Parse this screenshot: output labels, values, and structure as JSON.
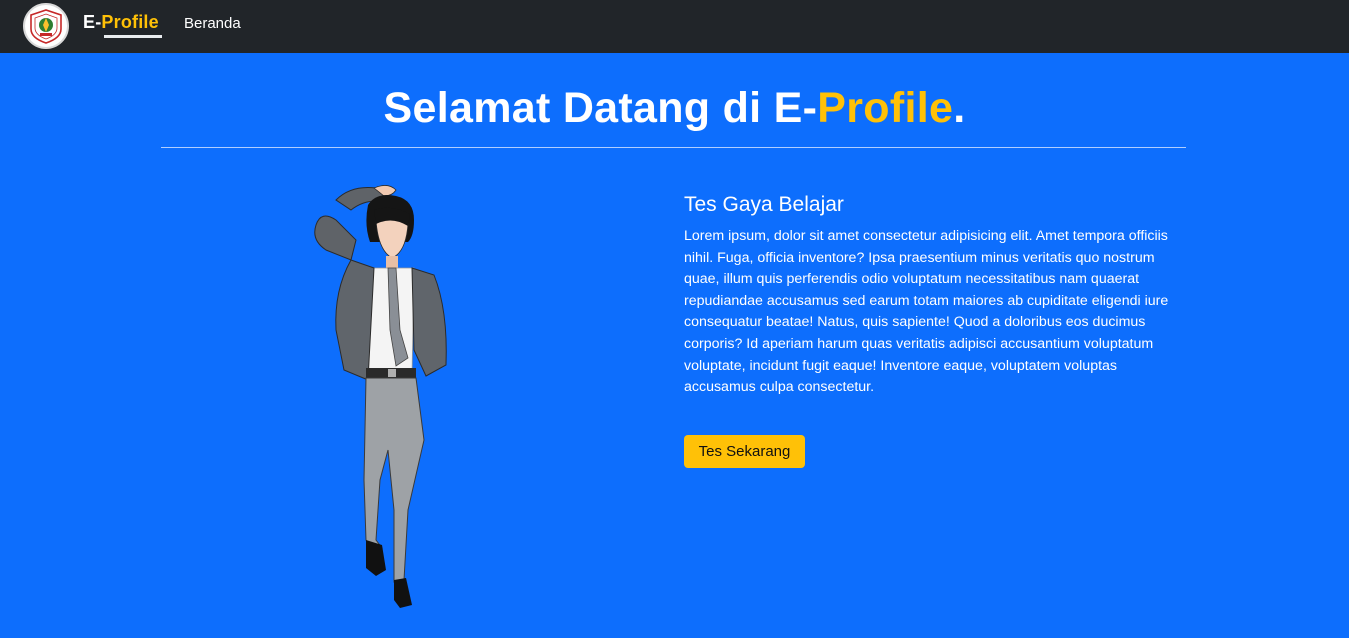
{
  "navbar": {
    "brand_prefix": "E-",
    "brand_accent": "Profile",
    "links": [
      {
        "label": "Beranda"
      }
    ]
  },
  "hero": {
    "title_prefix": "Selamat Datang di E-",
    "title_accent": "Profile",
    "title_suffix": "."
  },
  "section": {
    "heading": "Tes Gaya Belajar",
    "body": "Lorem ipsum, dolor sit amet consectetur adipisicing elit. Amet tempora officiis nihil. Fuga, officia inventore? Ipsa praesentium minus veritatis quo nostrum quae, illum quis perferendis odio voluptatum necessitatibus nam quaerat repudiandae accusamus sed earum totam maiores ab cupiditate eligendi iure consequatur beatae! Natus, quis sapiente! Quod a doloribus eos ducimus corporis? Id aperiam harum quas veritatis adipisci accusantium voluptatum voluptate, incidunt fugit eaque! Inventore eaque, voluptatem voluptas accusamus culpa consectetur.",
    "button_label": "Tes Sekarang"
  },
  "colors": {
    "navbar_bg": "#212529",
    "page_bg": "#0d6efd",
    "accent": "#ffc107"
  },
  "icons": {
    "logo": "school-logo-icon",
    "illustration": "student-character-illustration"
  }
}
